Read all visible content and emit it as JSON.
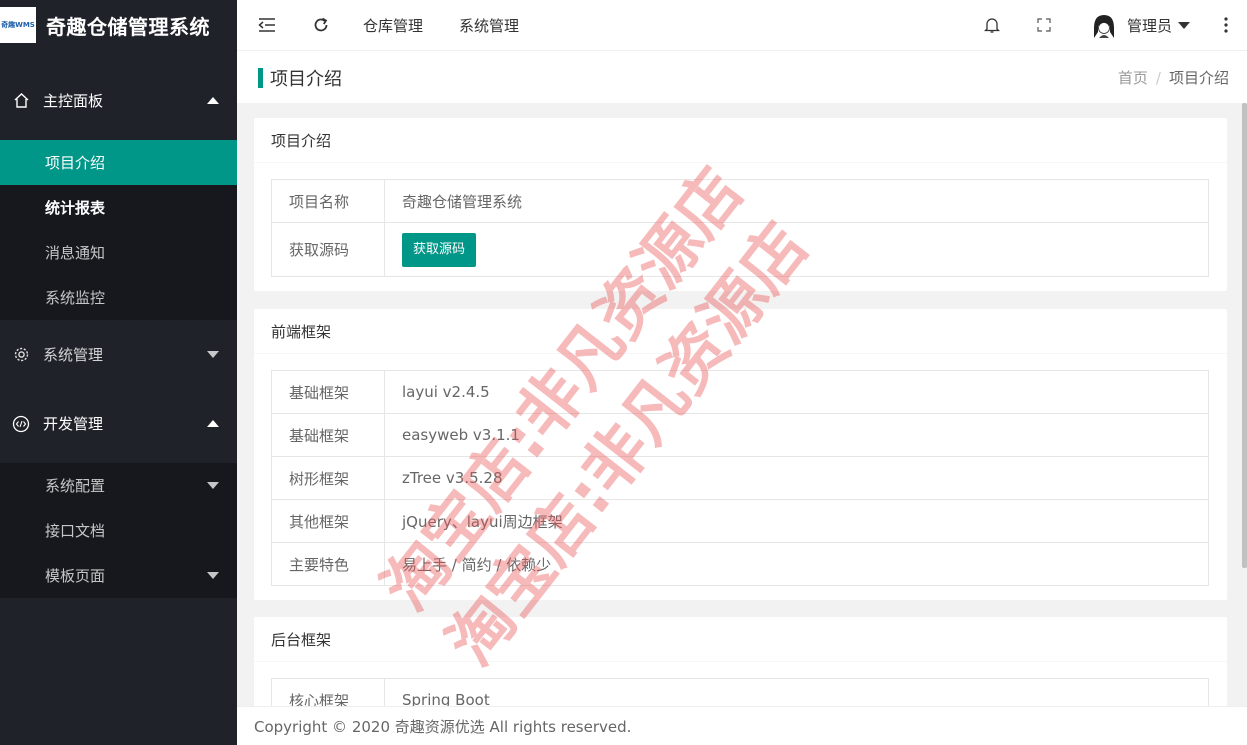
{
  "app": {
    "logo_text": "奇趣WMS",
    "title": "奇趣仓储管理系统"
  },
  "sidebar": {
    "groups": [
      {
        "label": "主控面板",
        "icon": "home-icon",
        "expanded": true,
        "items": [
          {
            "label": "项目介绍",
            "active": true
          },
          {
            "label": "统计报表",
            "bold": true
          },
          {
            "label": "消息通知"
          },
          {
            "label": "系统监控"
          }
        ]
      },
      {
        "label": "系统管理",
        "icon": "gear-icon",
        "expanded": false
      },
      {
        "label": "开发管理",
        "icon": "code-icon",
        "expanded": true,
        "items": [
          {
            "label": "系统配置",
            "has_children": true
          },
          {
            "label": "接口文档"
          },
          {
            "label": "模板页面",
            "has_children": true
          }
        ]
      }
    ]
  },
  "header": {
    "nav": [
      "仓库管理",
      "系统管理"
    ],
    "user_name": "管理员",
    "icons": [
      "collapse-sidebar-icon",
      "refresh-icon",
      "bell-icon",
      "fullscreen-icon",
      "more-vertical-icon"
    ]
  },
  "page": {
    "title": "项目介绍",
    "breadcrumb": [
      "首页",
      "/",
      "项目介绍"
    ]
  },
  "cards": [
    {
      "title": "项目介绍",
      "rows": [
        {
          "key": "项目名称",
          "value": "奇趣仓储管理系统"
        },
        {
          "key": "获取源码",
          "button": "获取源码"
        }
      ]
    },
    {
      "title": "前端框架",
      "rows": [
        {
          "key": "基础框架",
          "value": "layui v2.4.5"
        },
        {
          "key": "基础框架",
          "value": "easyweb v3.1.1"
        },
        {
          "key": "树形框架",
          "value": "zTree v3.5.28"
        },
        {
          "key": "其他框架",
          "value": "jQuery、layui周边框架"
        },
        {
          "key": "主要特色",
          "value": "易上手 / 简约 / 依赖少"
        }
      ]
    },
    {
      "title": "后台框架",
      "rows": [
        {
          "key": "核心框架",
          "value": "Spring Boot"
        }
      ]
    }
  ],
  "footer": "Copyright © 2020 奇趣资源优选 All rights reserved.",
  "watermark": [
    "淘宝店:非凡资源店",
    "淘宝店:非凡资源店"
  ],
  "colors": {
    "accent": "#009688",
    "sidebar": "#20222a",
    "submenu": "#16181d"
  }
}
